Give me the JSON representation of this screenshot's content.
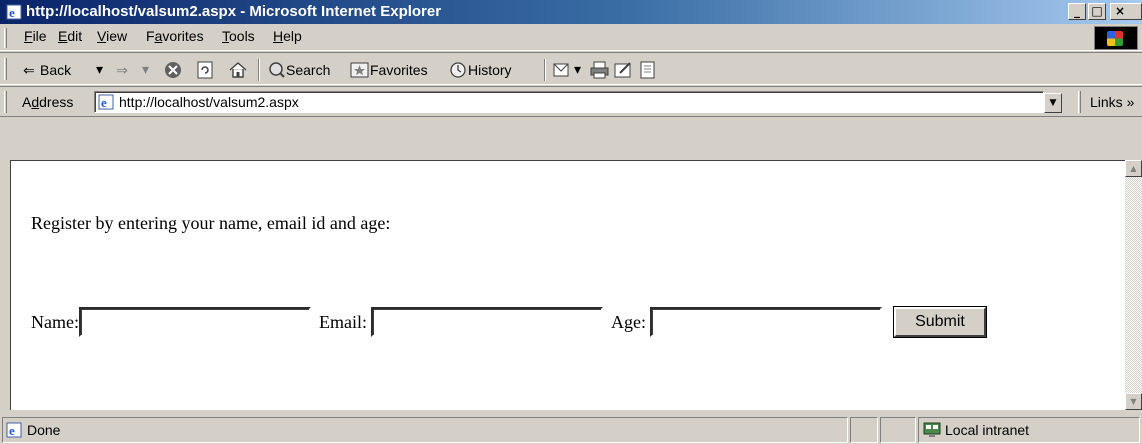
{
  "window": {
    "title": "http://localhost/valsum2.aspx - Microsoft Internet Explorer",
    "minimize_glyph": "_",
    "maximize_glyph": "□",
    "close_glyph": "×"
  },
  "menu": {
    "items": [
      {
        "accel": "F",
        "rest": "ile"
      },
      {
        "accel": "E",
        "rest": "dit"
      },
      {
        "accel": "V",
        "rest": "iew"
      },
      {
        "pre": "F",
        "accel": "a",
        "rest": "vorites"
      },
      {
        "accel": "T",
        "rest": "ools"
      },
      {
        "accel": "H",
        "rest": "elp"
      }
    ]
  },
  "toolbar": {
    "back_label": "Back",
    "back_dropdown": "▾",
    "forward_dropdown": "▾",
    "search_label": "Search",
    "favorites_label": "Favorites",
    "history_label": "History",
    "mail_dropdown": "▾"
  },
  "address": {
    "label_accel": "d",
    "label_pre": "A",
    "label_rest": "dress",
    "url": "http://localhost/valsum2.aspx",
    "links_label": "Links",
    "links_chevron": "»"
  },
  "page": {
    "intro": "Register by entering your name, email id and age:",
    "name_label": "Name:",
    "email_label": "Email:",
    "age_label": "Age:",
    "name_value": "",
    "email_value": "",
    "age_value": "",
    "submit_label": "Submit"
  },
  "status": {
    "text": "Done",
    "zone": "Local intranet"
  },
  "colors": {
    "titlebar_start": "#0a246a",
    "titlebar_end": "#a6caf0",
    "chrome": "#d4d0c8",
    "page_bg": "#ffffff"
  }
}
